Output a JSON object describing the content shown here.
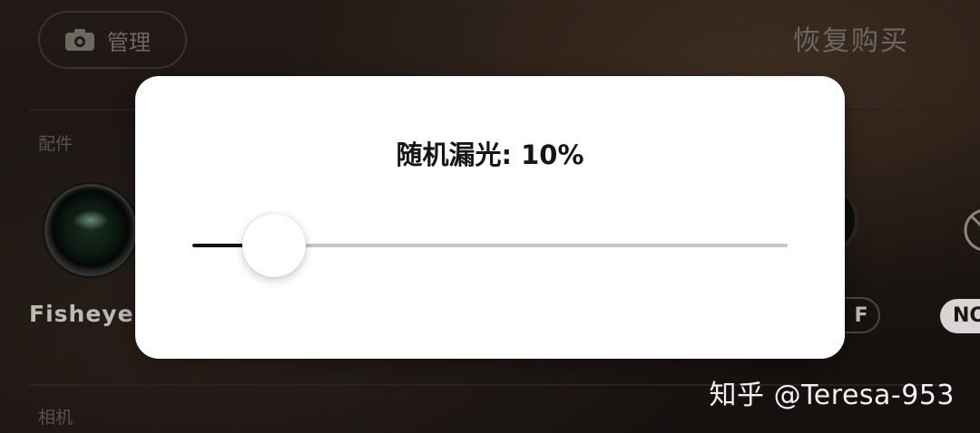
{
  "header": {
    "manage_label": "管理",
    "restore_purchase_label": "恢复购买"
  },
  "sections": {
    "accessories_label": "配件",
    "camera_label": "相机"
  },
  "accessories": {
    "first_item_label": "Fisheye W",
    "partial_badge_label": "F",
    "partial_pill_label": "NO"
  },
  "dialog": {
    "title": "随机漏光: 10%",
    "slider_value": 0.1
  },
  "watermark": "知乎 @Teresa-953",
  "icons": [
    "camera-icon",
    "lens-thumbnail",
    "no-filter-icon"
  ]
}
